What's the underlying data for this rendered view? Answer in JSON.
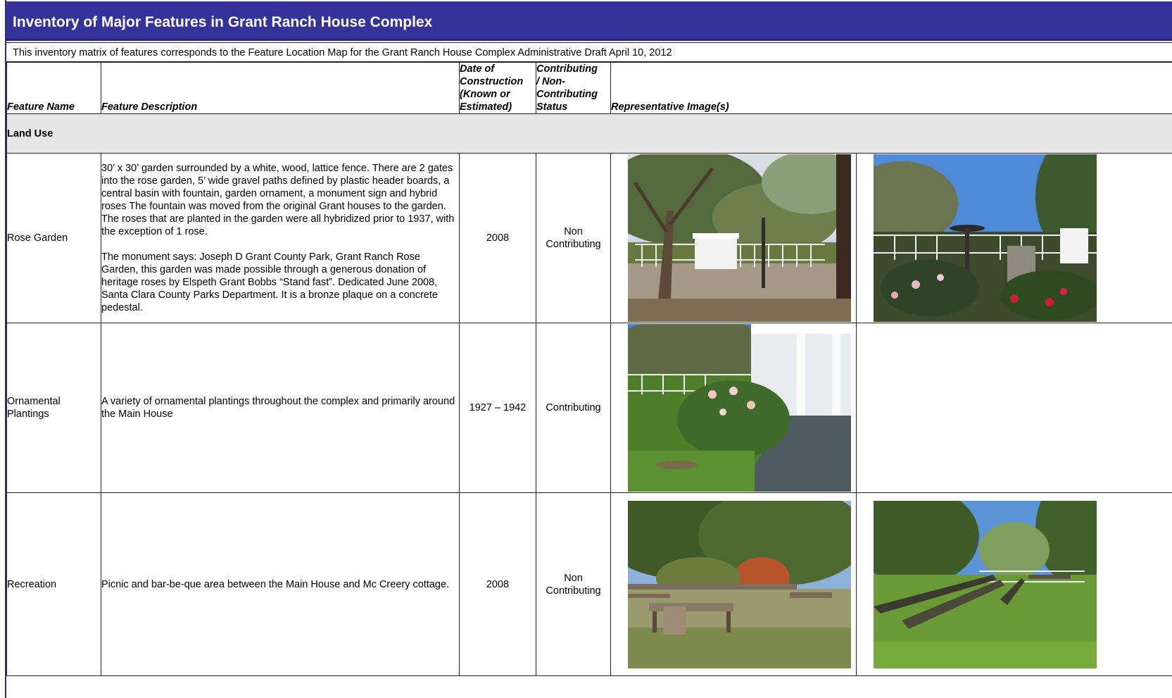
{
  "header": {
    "title": "Inventory of Major Features in Grant Ranch House Complex",
    "note": "This inventory matrix of features corresponds to the Feature Location Map for the Grant Ranch House Complex Administrative Draft April 10, 2012"
  },
  "columns": {
    "name": "Feature Name",
    "description": "Feature Description",
    "date": [
      "Date of",
      "Construction",
      "(Known or",
      "Estimated)"
    ],
    "status": [
      "Contributing",
      "/ Non-",
      "Contributing",
      "Status"
    ],
    "images": "Representative Image(s)"
  },
  "section": {
    "label": "Land Use"
  },
  "rows": [
    {
      "name": "Rose Garden",
      "description": [
        "30’ x 30’ garden surrounded by a white, wood, lattice fence.  There are 2 gates into the rose garden, 5’ wide gravel paths defined by plastic header boards, a central basin with fountain, garden ornament, a monument sign and hybrid roses  The fountain was moved from the original Grant houses to the garden.  The roses that are planted in the garden were all hybridized prior to 1937, with the exception of 1 rose.",
        "The monument says: Joseph D Grant County Park, Grant Ranch Rose Garden, this garden was made possible through a generous donation of heritage roses by Elspeth Grant Bobbs “Stand fast”.  Dedicated June 2008, Santa Clara County Parks Department.  It is a bronze plaque on a concrete pedestal."
      ],
      "date": "2008",
      "status": [
        "Non",
        "Contributing"
      ],
      "images": [
        "rose-garden-gate-photo",
        "rose-garden-fountain-photo"
      ]
    },
    {
      "name": [
        "Ornamental",
        "Plantings"
      ],
      "description": [
        "A variety of ornamental plantings throughout the complex and primarily around the Main House"
      ],
      "date": "1927 – 1942",
      "status": [
        "Contributing"
      ],
      "images": [
        "rose-bush-by-porch-photo"
      ]
    },
    {
      "name": "Recreation",
      "description": [
        "Picnic and bar-be-que area between the Main House and Mc Creery cottage."
      ],
      "date": "2008",
      "status": [
        "Non",
        "Contributing"
      ],
      "images": [
        "picnic-area-photo",
        "picnic-tables-lawn-photo"
      ]
    }
  ],
  "colors": {
    "title_bar": "#333399",
    "section_bg": "#e6e6e6"
  }
}
